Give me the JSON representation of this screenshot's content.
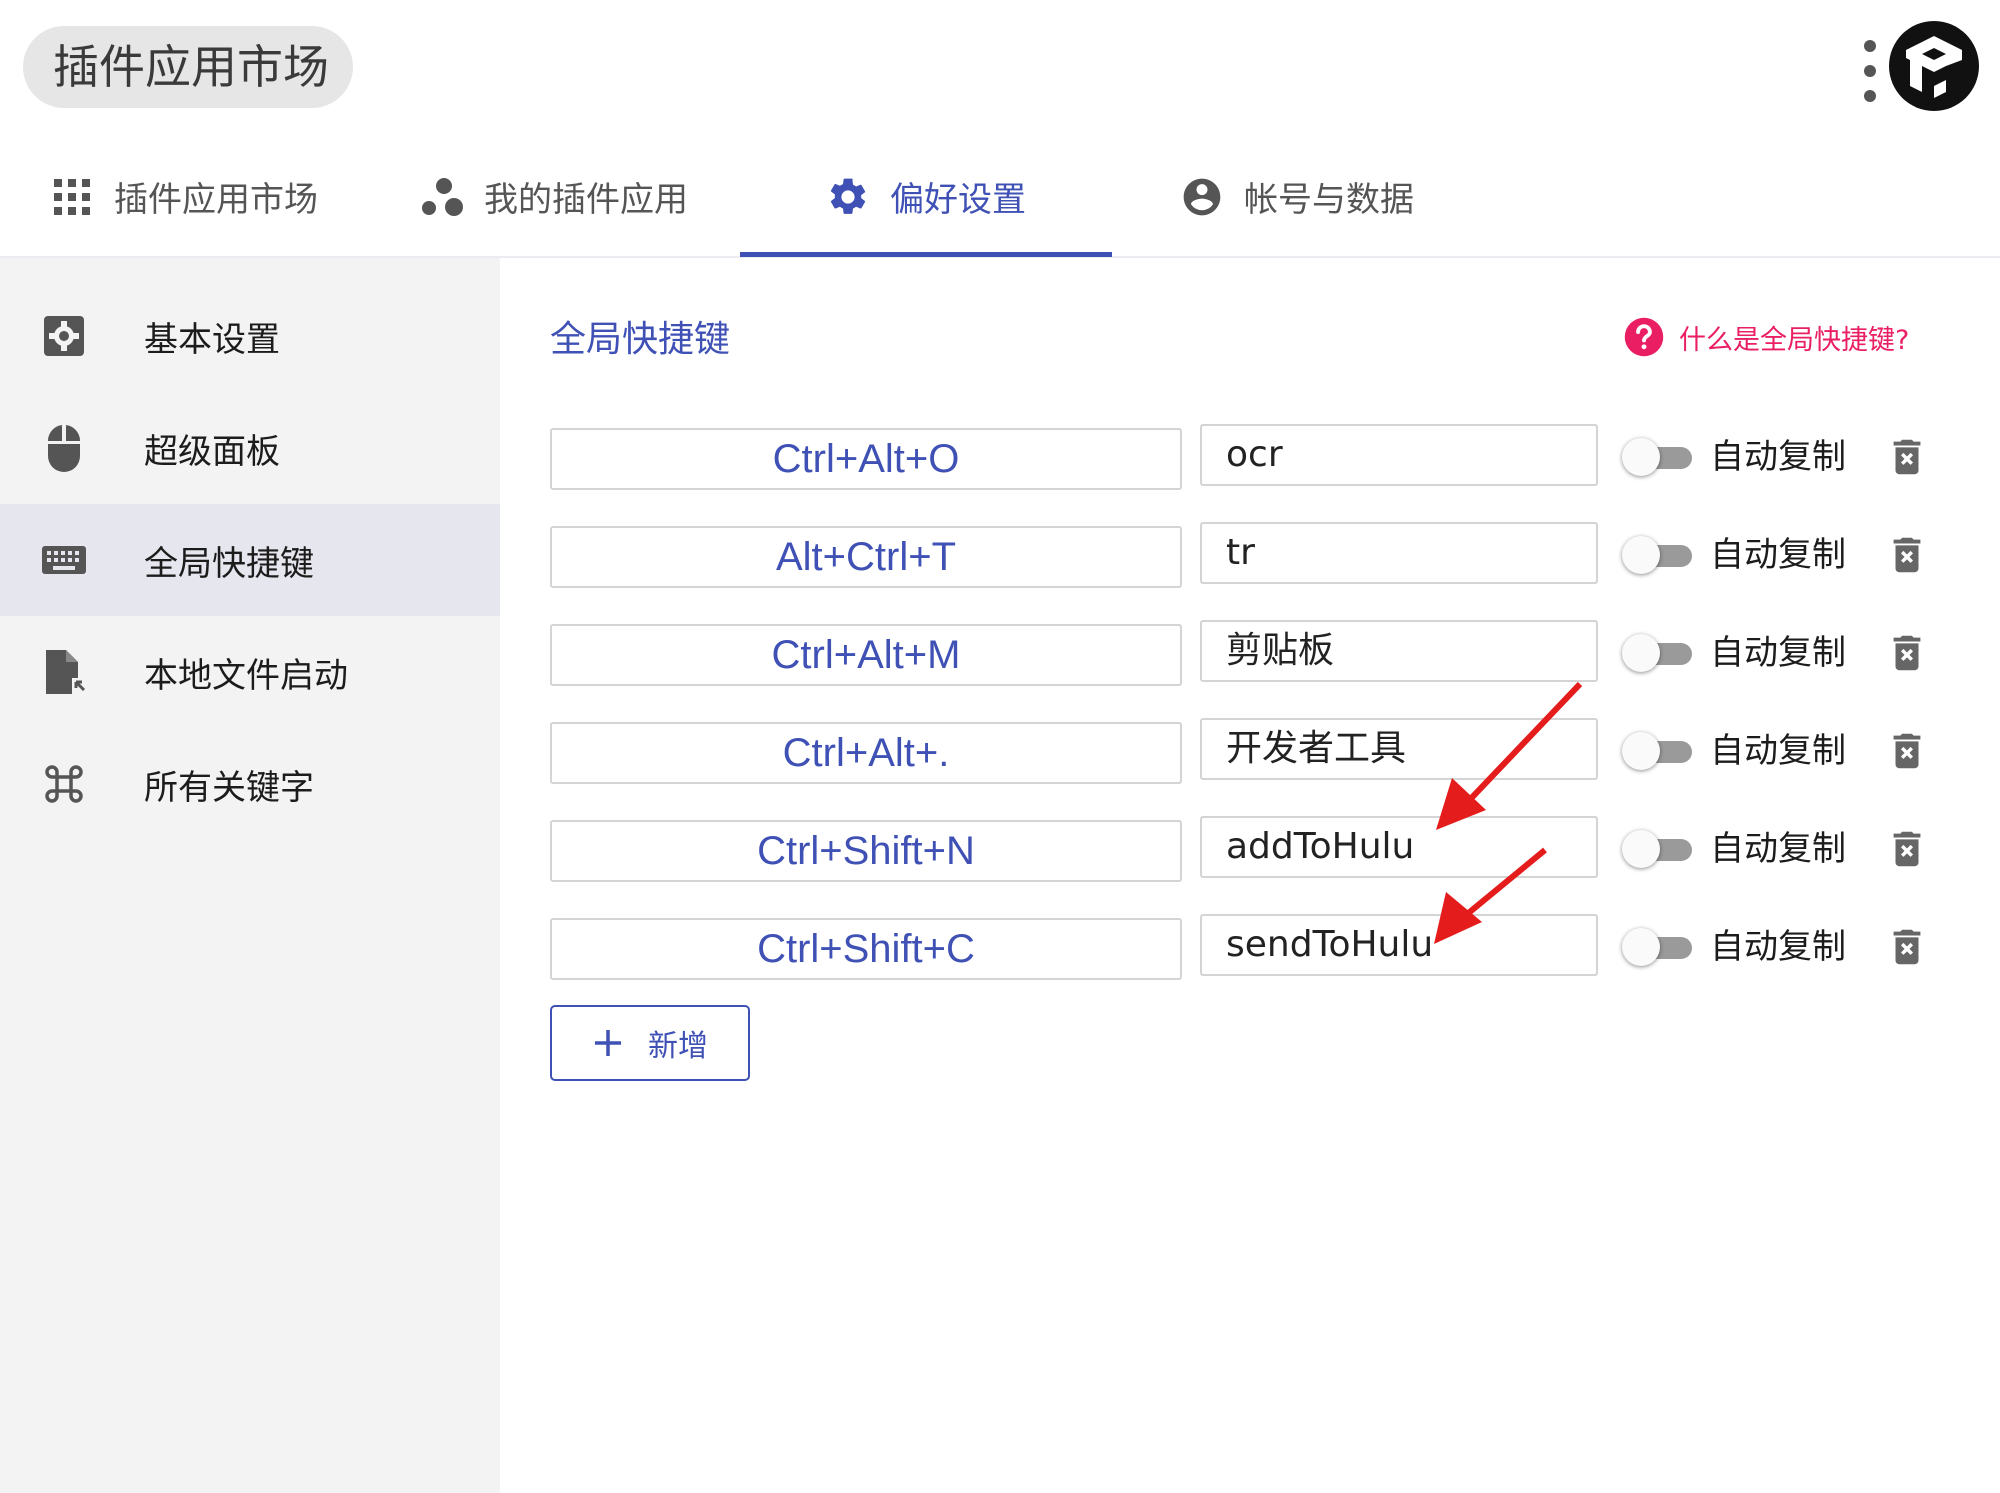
{
  "header": {
    "search_text": "插件应用市场"
  },
  "tabs": [
    {
      "label": "插件应用市场",
      "icon": "apps-grid-icon"
    },
    {
      "label": "我的插件应用",
      "icon": "bubble-chart-icon"
    },
    {
      "label": "偏好设置",
      "icon": "gear-icon",
      "active": true
    },
    {
      "label": "帐号与数据",
      "icon": "account-circle-icon"
    }
  ],
  "sidebar": {
    "items": [
      {
        "label": "基本设置",
        "icon": "settings-box-icon"
      },
      {
        "label": "超级面板",
        "icon": "mouse-icon"
      },
      {
        "label": "全局快捷键",
        "icon": "keyboard-icon",
        "active": true
      },
      {
        "label": "本地文件启动",
        "icon": "file-launch-icon"
      },
      {
        "label": "所有关键字",
        "icon": "command-key-icon"
      }
    ]
  },
  "main": {
    "title": "全局快捷键",
    "help_link": "什么是全局快捷键?",
    "auto_copy_label": "自动复制",
    "add_button_label": "新增",
    "rows": [
      {
        "hotkey": "Ctrl+Alt+O",
        "command": "ocr",
        "auto_copy": false
      },
      {
        "hotkey": "Alt+Ctrl+T",
        "command": "tr",
        "auto_copy": false
      },
      {
        "hotkey": "Ctrl+Alt+M",
        "command": "剪贴板",
        "auto_copy": false
      },
      {
        "hotkey": "Ctrl+Alt+.",
        "command": "开发者工具",
        "auto_copy": false
      },
      {
        "hotkey": "Ctrl+Shift+N",
        "command": "addToHulu",
        "auto_copy": false
      },
      {
        "hotkey": "Ctrl+Shift+C",
        "command": "sendToHulu",
        "auto_copy": false
      }
    ]
  },
  "colors": {
    "accent": "#3f51b5",
    "help_link": "#e91e63",
    "annotation_arrow": "#e51c1c",
    "sidebar_bg": "#f3f3f4",
    "sidebar_active_bg": "#e6e6ee"
  }
}
